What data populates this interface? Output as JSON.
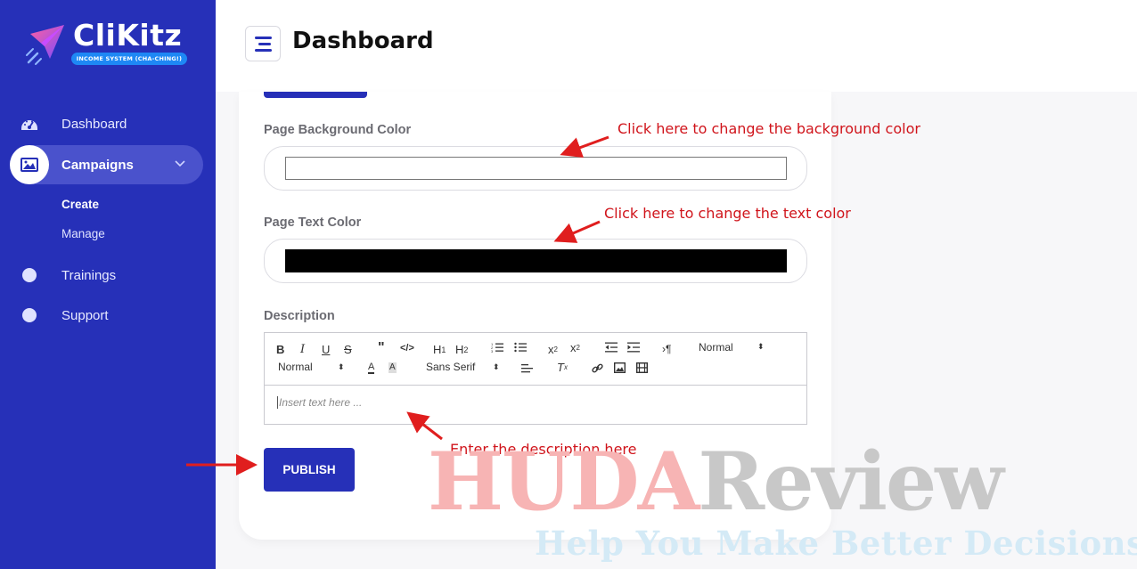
{
  "brand": {
    "name": "CliKitz",
    "tagline": "INCOME SYSTEM (CHA-CHING!)"
  },
  "sidebar": {
    "items": [
      {
        "label": "Dashboard",
        "icon": "speedometer-icon"
      },
      {
        "label": "Campaigns",
        "icon": "image-icon",
        "active": true
      },
      {
        "label": "Trainings",
        "icon": "dot-icon"
      },
      {
        "label": "Support",
        "icon": "dot-icon"
      }
    ],
    "subitems": [
      "Create",
      "Manage"
    ]
  },
  "header": {
    "title": "Dashboard"
  },
  "form": {
    "bg_color_label": "Page Background Color",
    "bg_color_value": "#ffffff",
    "text_color_label": "Page Text Color",
    "text_color_value": "#000000",
    "description_label": "Description",
    "editor": {
      "header_select": "Normal",
      "size_select": "Normal",
      "font_select": "Sans Serif",
      "placeholder": "Insert text here ..."
    },
    "publish_label": "PUBLISH"
  },
  "annotations": {
    "bg_hint": "Click here to change the background color",
    "text_hint": "Click here to change the text color",
    "desc_hint": "Enter the description here"
  },
  "watermark": {
    "huda": "HUDA",
    "review": "Review",
    "slogan": "Help You Make Better Decisions"
  },
  "colors": {
    "sidebar": "#2630b8",
    "accent": "#2630b8",
    "annotation": "#d0141b"
  }
}
